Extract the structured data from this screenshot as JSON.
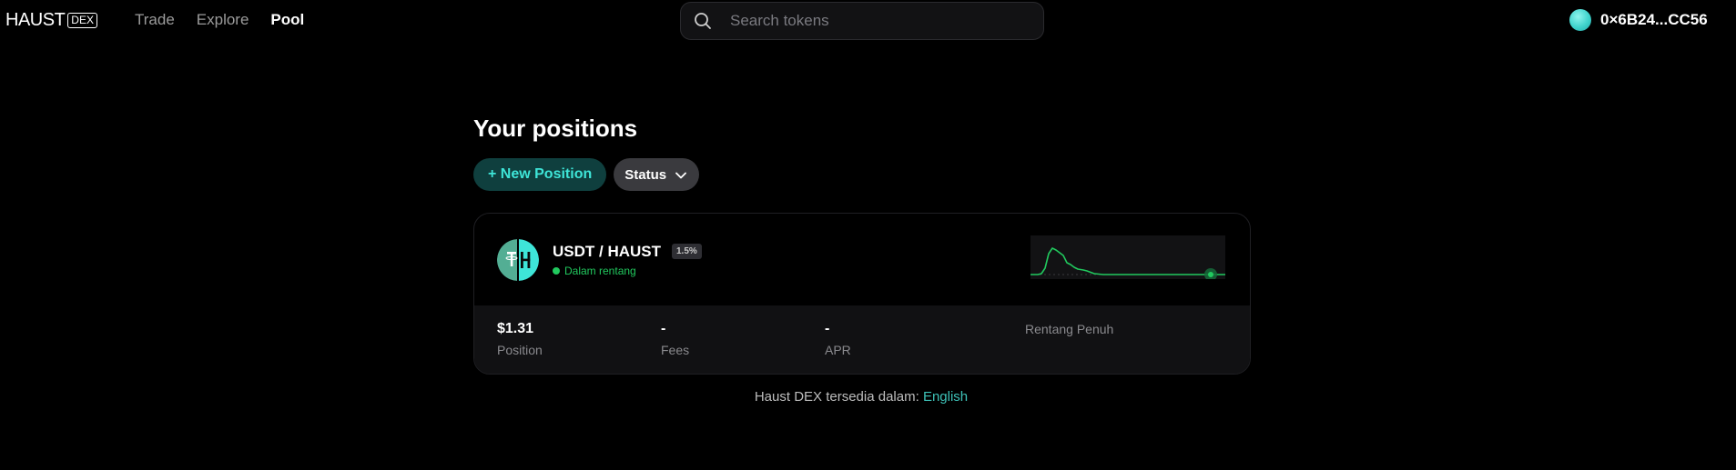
{
  "header": {
    "logo_text": "HAUST",
    "logo_badge": "DEX",
    "nav": [
      {
        "label": "Trade",
        "active": false
      },
      {
        "label": "Explore",
        "active": false
      },
      {
        "label": "Pool",
        "active": true
      }
    ],
    "search_placeholder": "Search tokens",
    "wallet_address": "0×6B24...CC56"
  },
  "main": {
    "title": "Your positions",
    "new_position_label": "+ New Position",
    "status_label": "Status"
  },
  "position": {
    "pair": "USDT / HAUST",
    "fee_tier": "1.5%",
    "range_status": "Dalam rentang",
    "value": "$1.31",
    "value_label": "Position",
    "fees": "-",
    "fees_label": "Fees",
    "apr": "-",
    "apr_label": "APR",
    "range_type": "Rentang Penuh"
  },
  "footer": {
    "text": "Haust DEX tersedia dalam: ",
    "language_link": "English"
  },
  "colors": {
    "accent": "#3ee5d8",
    "in_range": "#21c95e",
    "background": "#000000"
  }
}
